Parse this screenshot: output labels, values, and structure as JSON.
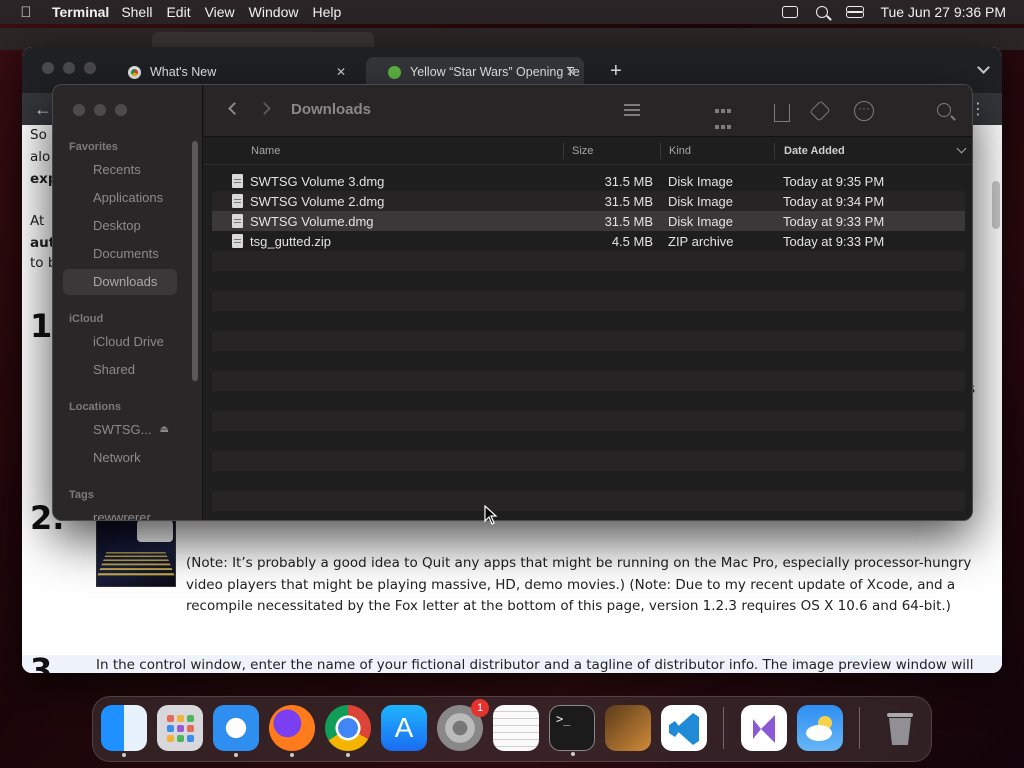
{
  "menubar": {
    "apple_icon": "apple-logo-icon",
    "app_name": "Terminal",
    "items": [
      "Shell",
      "Edit",
      "View",
      "Window",
      "Help"
    ],
    "clock": "Tue Jun 27  9:36 PM"
  },
  "browser": {
    "tabs": [
      {
        "title": "What's New",
        "icon": "chrome-icon"
      },
      {
        "title": "Yellow “Star Wars” Opening Te",
        "icon": "green-favicon"
      }
    ],
    "page": {
      "frag_so": "So",
      "frag_alo": "alo",
      "frag_exp": "exp",
      "frag_at": "At",
      "frag_aut": "aut",
      "frag_tob": "to b",
      "frag_s": "s",
      "step1": "1",
      "step2": "2.",
      "step3": "3",
      "step2_note": "(Note: It’s probably a good idea to Quit any apps that might be running on the Mac Pro, especially processor-hungry video players that might be playing massive, HD, demo movies.) (Note: Due to my recent update of Xcode, and a recompile necessitated by the Fox letter at the bottom of this page, version 1.2.3 requires OS X 10.6 and 64-bit.)",
      "step3_text": "In the control window, enter the name of your fictional distributor and a tagline of distributor info. The image preview window will"
    }
  },
  "finder": {
    "title": "Downloads",
    "sidebar": {
      "favorites_label": "Favorites",
      "favorites": [
        "Recents",
        "Applications",
        "Desktop",
        "Documents",
        "Downloads"
      ],
      "icloud_label": "iCloud",
      "icloud": [
        "iCloud Drive",
        "Shared"
      ],
      "locations_label": "Locations",
      "locations": [
        "SWTSG...",
        "Network"
      ],
      "tags_label": "Tags",
      "tags_partial": "rewwrerer"
    },
    "columns": {
      "name": "Name",
      "size": "Size",
      "kind": "Kind",
      "date": "Date Added"
    },
    "files": [
      {
        "name": "SWTSG Volume 3.dmg",
        "size": "31.5 MB",
        "kind": "Disk Image",
        "date": "Today at 9:35 PM"
      },
      {
        "name": "SWTSG Volume 2.dmg",
        "size": "31.5 MB",
        "kind": "Disk Image",
        "date": "Today at 9:34 PM"
      },
      {
        "name": "SWTSG Volume.dmg",
        "size": "31.5 MB",
        "kind": "Disk Image",
        "date": "Today at 9:33 PM"
      },
      {
        "name": "tsg_gutted.zip",
        "size": "4.5 MB",
        "kind": "ZIP archive",
        "date": "Today at 9:33 PM"
      }
    ]
  },
  "dock": {
    "apps": [
      "finder-icon",
      "launchpad-icon",
      "safari-icon",
      "firefox-icon",
      "chrome-icon",
      "app-store-icon",
      "system-settings-icon",
      "textedit-icon",
      "terminal-icon",
      "garageband-icon",
      "vscode-icon",
      "visual-studio-icon",
      "weather-icon",
      "trash-icon"
    ],
    "settings_badge": "1"
  }
}
